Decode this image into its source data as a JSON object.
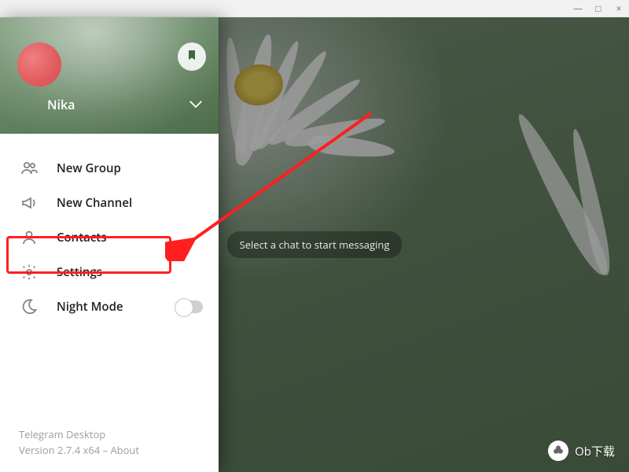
{
  "window": {
    "minimize": "—",
    "maximize": "□",
    "close": "×"
  },
  "chat": {
    "empty_prompt": "Select a chat to start messaging"
  },
  "drawer": {
    "username": "Nika",
    "items": [
      {
        "icon": "group-icon",
        "label": "New Group"
      },
      {
        "icon": "channel-icon",
        "label": "New Channel"
      },
      {
        "icon": "contacts-icon",
        "label": "Contacts"
      },
      {
        "icon": "settings-icon",
        "label": "Settings"
      },
      {
        "icon": "night-icon",
        "label": "Night Mode",
        "toggle": false
      }
    ],
    "footer": {
      "app_name": "Telegram Desktop",
      "version_line": "Version 2.7.4 x64 – About",
      "about_word": "About"
    }
  },
  "annotation": {
    "highlighted_item_index": 3
  },
  "watermark": {
    "text": "Ob下载"
  }
}
